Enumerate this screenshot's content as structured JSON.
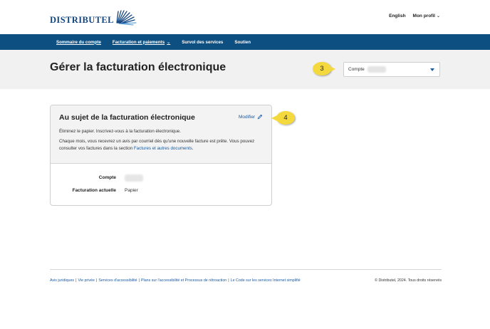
{
  "header": {
    "logo_text": "DISTRIBUTEL",
    "lang_link": "English",
    "profile_link": "Mon profil"
  },
  "nav": {
    "items": [
      {
        "label": "Sommaire du compte"
      },
      {
        "label": "Facturation et paiements"
      },
      {
        "label": "Survol des services"
      },
      {
        "label": "Soutien"
      }
    ]
  },
  "page": {
    "title": "Gérer la facturation électronique",
    "account_label": "Compte"
  },
  "callouts": {
    "three": "3",
    "four": "4"
  },
  "card": {
    "title": "Au sujet de la facturation électronique",
    "edit_label": "Modifier",
    "text1": "Éliminez le papier. Inscrivez-vous à la facturation électronique.",
    "text2_part1": "Chaque mois, vous recevrez un avis par courriel dès qu'une nouvelle facture est prête. Vous pouvez consulter vos factures dans la section ",
    "text2_link": "Factures et autres documents",
    "text2_end": ".",
    "rows": [
      {
        "label": "Compte",
        "value": ""
      },
      {
        "label": "Facturation actuelle",
        "value": "Papier"
      }
    ]
  },
  "footer": {
    "links": [
      "Avis juridiques",
      "Vie privée",
      "Services d'accessibilité",
      "Plans sur l'accessibilité et Processus de rétroaction",
      "Le Code sur les services Internet simplifié"
    ],
    "copyright": "© Distributel, 2024. Tous droits réservés"
  },
  "colors": {
    "nav_bg": "#0e4f82",
    "link": "#1a5aa0",
    "callout": "#f4d93e",
    "banner_bg": "#f1f1f1"
  }
}
